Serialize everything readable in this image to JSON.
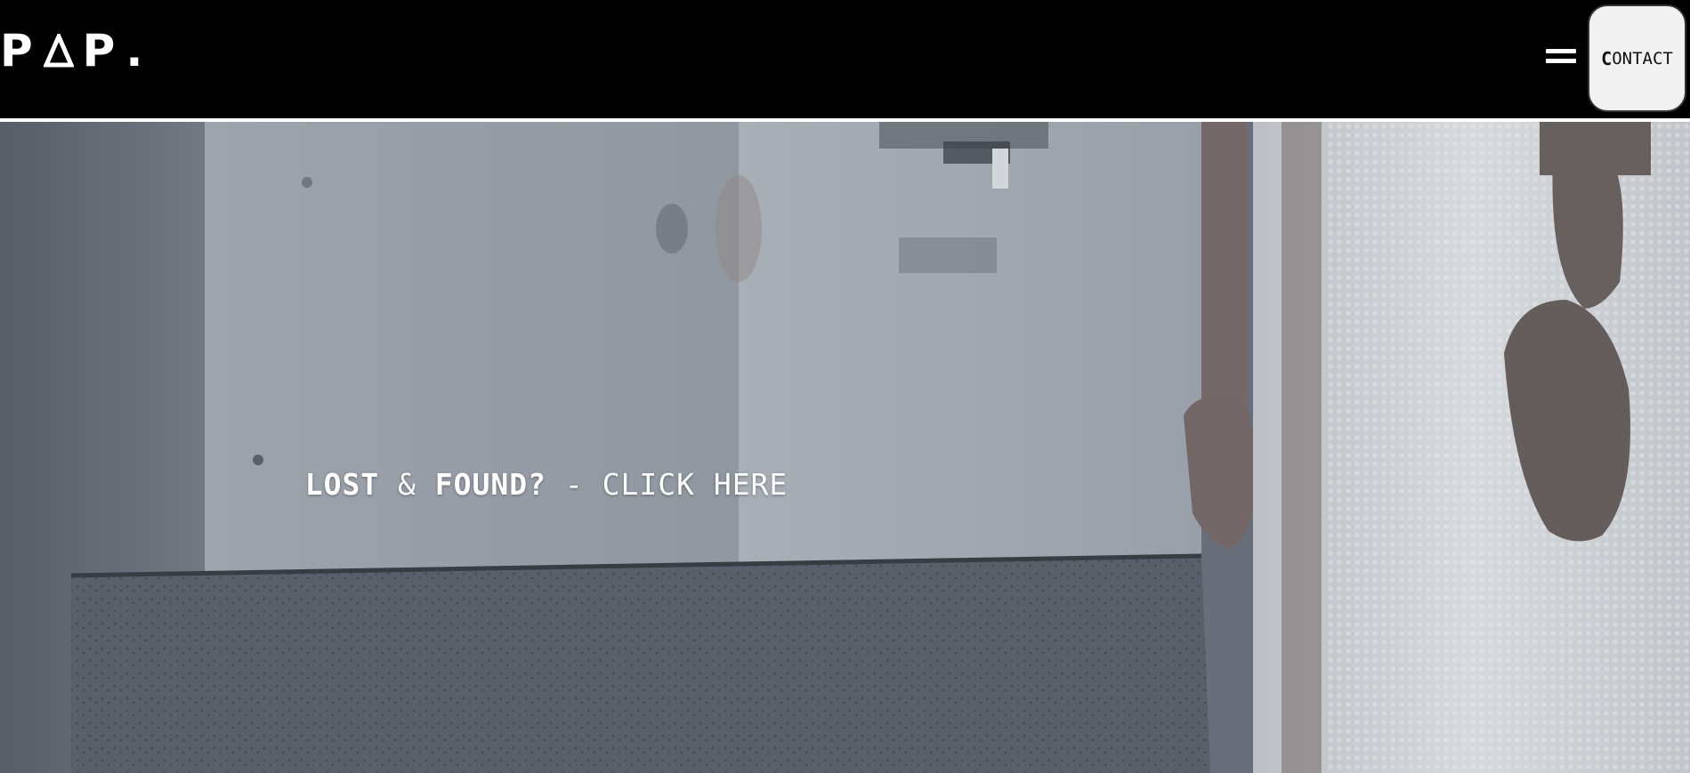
{
  "header": {
    "logo": {
      "letter_1": "P",
      "letter_3": "P",
      "dot": "."
    },
    "menu_icon": "hamburger-menu-icon",
    "contact": {
      "first_letter": "C",
      "rest": "ONTACT"
    }
  },
  "hero": {
    "image_description": "blurred grey wall with tap, hands and bubble-wrap fabric",
    "cta": {
      "part_1": "LOST",
      "amp": " & ",
      "part_2": "FOUND?",
      "suffix": " - CLICK HERE"
    }
  },
  "colors": {
    "header_bg": "#000000",
    "contact_bg": "#f1f1f1",
    "divider": "#ffffff",
    "cta_text": "#ffffff"
  }
}
